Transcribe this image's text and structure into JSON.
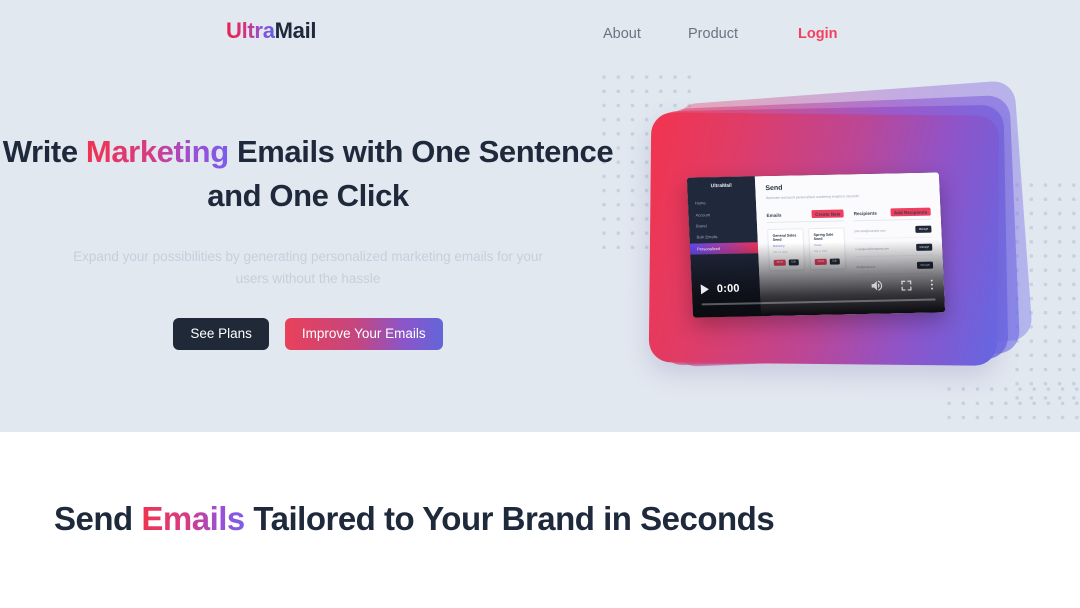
{
  "brand": {
    "part1": "Ultra",
    "part2": "Mail"
  },
  "nav": {
    "items": [
      {
        "label": "About",
        "name": "nav-link-about"
      },
      {
        "label": "Product",
        "name": "nav-link-product"
      },
      {
        "label": "Login",
        "name": "nav-link-login"
      }
    ]
  },
  "hero": {
    "headline": {
      "before": "Write ",
      "highlight": "Marketing",
      "after": " Emails with One Sentence and One Click"
    },
    "subhead": "Expand your possibilities by generating personalized marketing emails for your users without the hassle",
    "buttons": {
      "secondary": "See Plans",
      "primary": "Improve Your Emails"
    }
  },
  "video": {
    "time": "0:00",
    "icons": {
      "play": "play-icon",
      "volume": "volume-icon",
      "fullscreen": "fullscreen-icon",
      "more": "more-options-icon"
    },
    "app": {
      "logo": "UltraMail",
      "nav": [
        "Home",
        "Account",
        "Brand",
        "Bulk Emails",
        "Personalized"
      ],
      "title": "Send",
      "subtitle": "Generate and send personalized marketing emails in seconds",
      "emails_heading": "Emails",
      "emails_action": "Create New",
      "recipients_heading": "Recipients",
      "recipients_action": "Add Recipients",
      "cards": [
        {
          "title": "General Sales Send",
          "label": "Marketing",
          "date": "Mar 14, 2023",
          "btn1": "Send",
          "btn2": "Edit"
        },
        {
          "title": "Spring Sale Send",
          "label": "Promo",
          "date": "Mar 9, 2023",
          "btn1": "Send",
          "btn2": "Edit"
        }
      ],
      "recipients": [
        {
          "email": "john.doe@example.com",
          "btn": "Manage"
        },
        {
          "email": "s.vasquez@company.com",
          "btn": "Manage"
        },
        {
          "email": "info@mail.com",
          "btn": "Manage"
        }
      ]
    }
  },
  "section2": {
    "heading": {
      "before": "Send ",
      "highlight": "Emails",
      "after": " Tailored to Your Brand in Seconds"
    }
  },
  "colors": {
    "hero_bg": "#E2E8F0",
    "dark": "#1E293B",
    "accent_red": "#F43F5E",
    "accent_purple": "#6366D9",
    "muted": "#C6CFDC",
    "dot": "#C3D3E2"
  }
}
